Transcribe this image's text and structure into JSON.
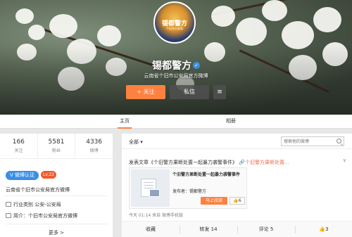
{
  "profile": {
    "avatar_text": "锡都警方",
    "avatar_sub": "个旧市公安局",
    "nickname": "锡都警方",
    "intro": "云南省个旧市公安局官方微博",
    "follow_label": "+ 关注",
    "message_label": "私信",
    "more_label": "≡"
  },
  "tabs": {
    "home": "主页",
    "album": "相册"
  },
  "stats": [
    {
      "num": "166",
      "label": "关注"
    },
    {
      "num": "5581",
      "label": "粉丝"
    },
    {
      "num": "4336",
      "label": "微博"
    }
  ],
  "badges": {
    "verified": "微博认证",
    "level": "Lv.22"
  },
  "verify_text": "云南省个旧市公安局官方微博",
  "info": {
    "industry": "行业类别  公安-公安局",
    "bio": "简介：个旧市公安局官方微博"
  },
  "more_link": "更多 >",
  "filter": {
    "all": "全部 ▾",
    "search_placeholder": "搜索他的微博"
  },
  "post": {
    "head_prefix": "发表文章《个旧警方果断处置一起暴力袭警事件》",
    "head_link": "个旧警方果断处置…",
    "card_title": "个旧警方果断处置一起暴力袭警事件",
    "card_author": "发布者：锡都警方",
    "read_btn": "马上阅读",
    "card_like": "6",
    "meta": "今天 01:14 来自 微博手机版",
    "actions": {
      "fav": "收藏",
      "repost": "转发 14",
      "comment": "评论 5",
      "like": "3"
    }
  },
  "colors": {
    "accent": "#ff8140",
    "verified_blue": "#3a8ee6",
    "level_red": "#f25a2c"
  }
}
